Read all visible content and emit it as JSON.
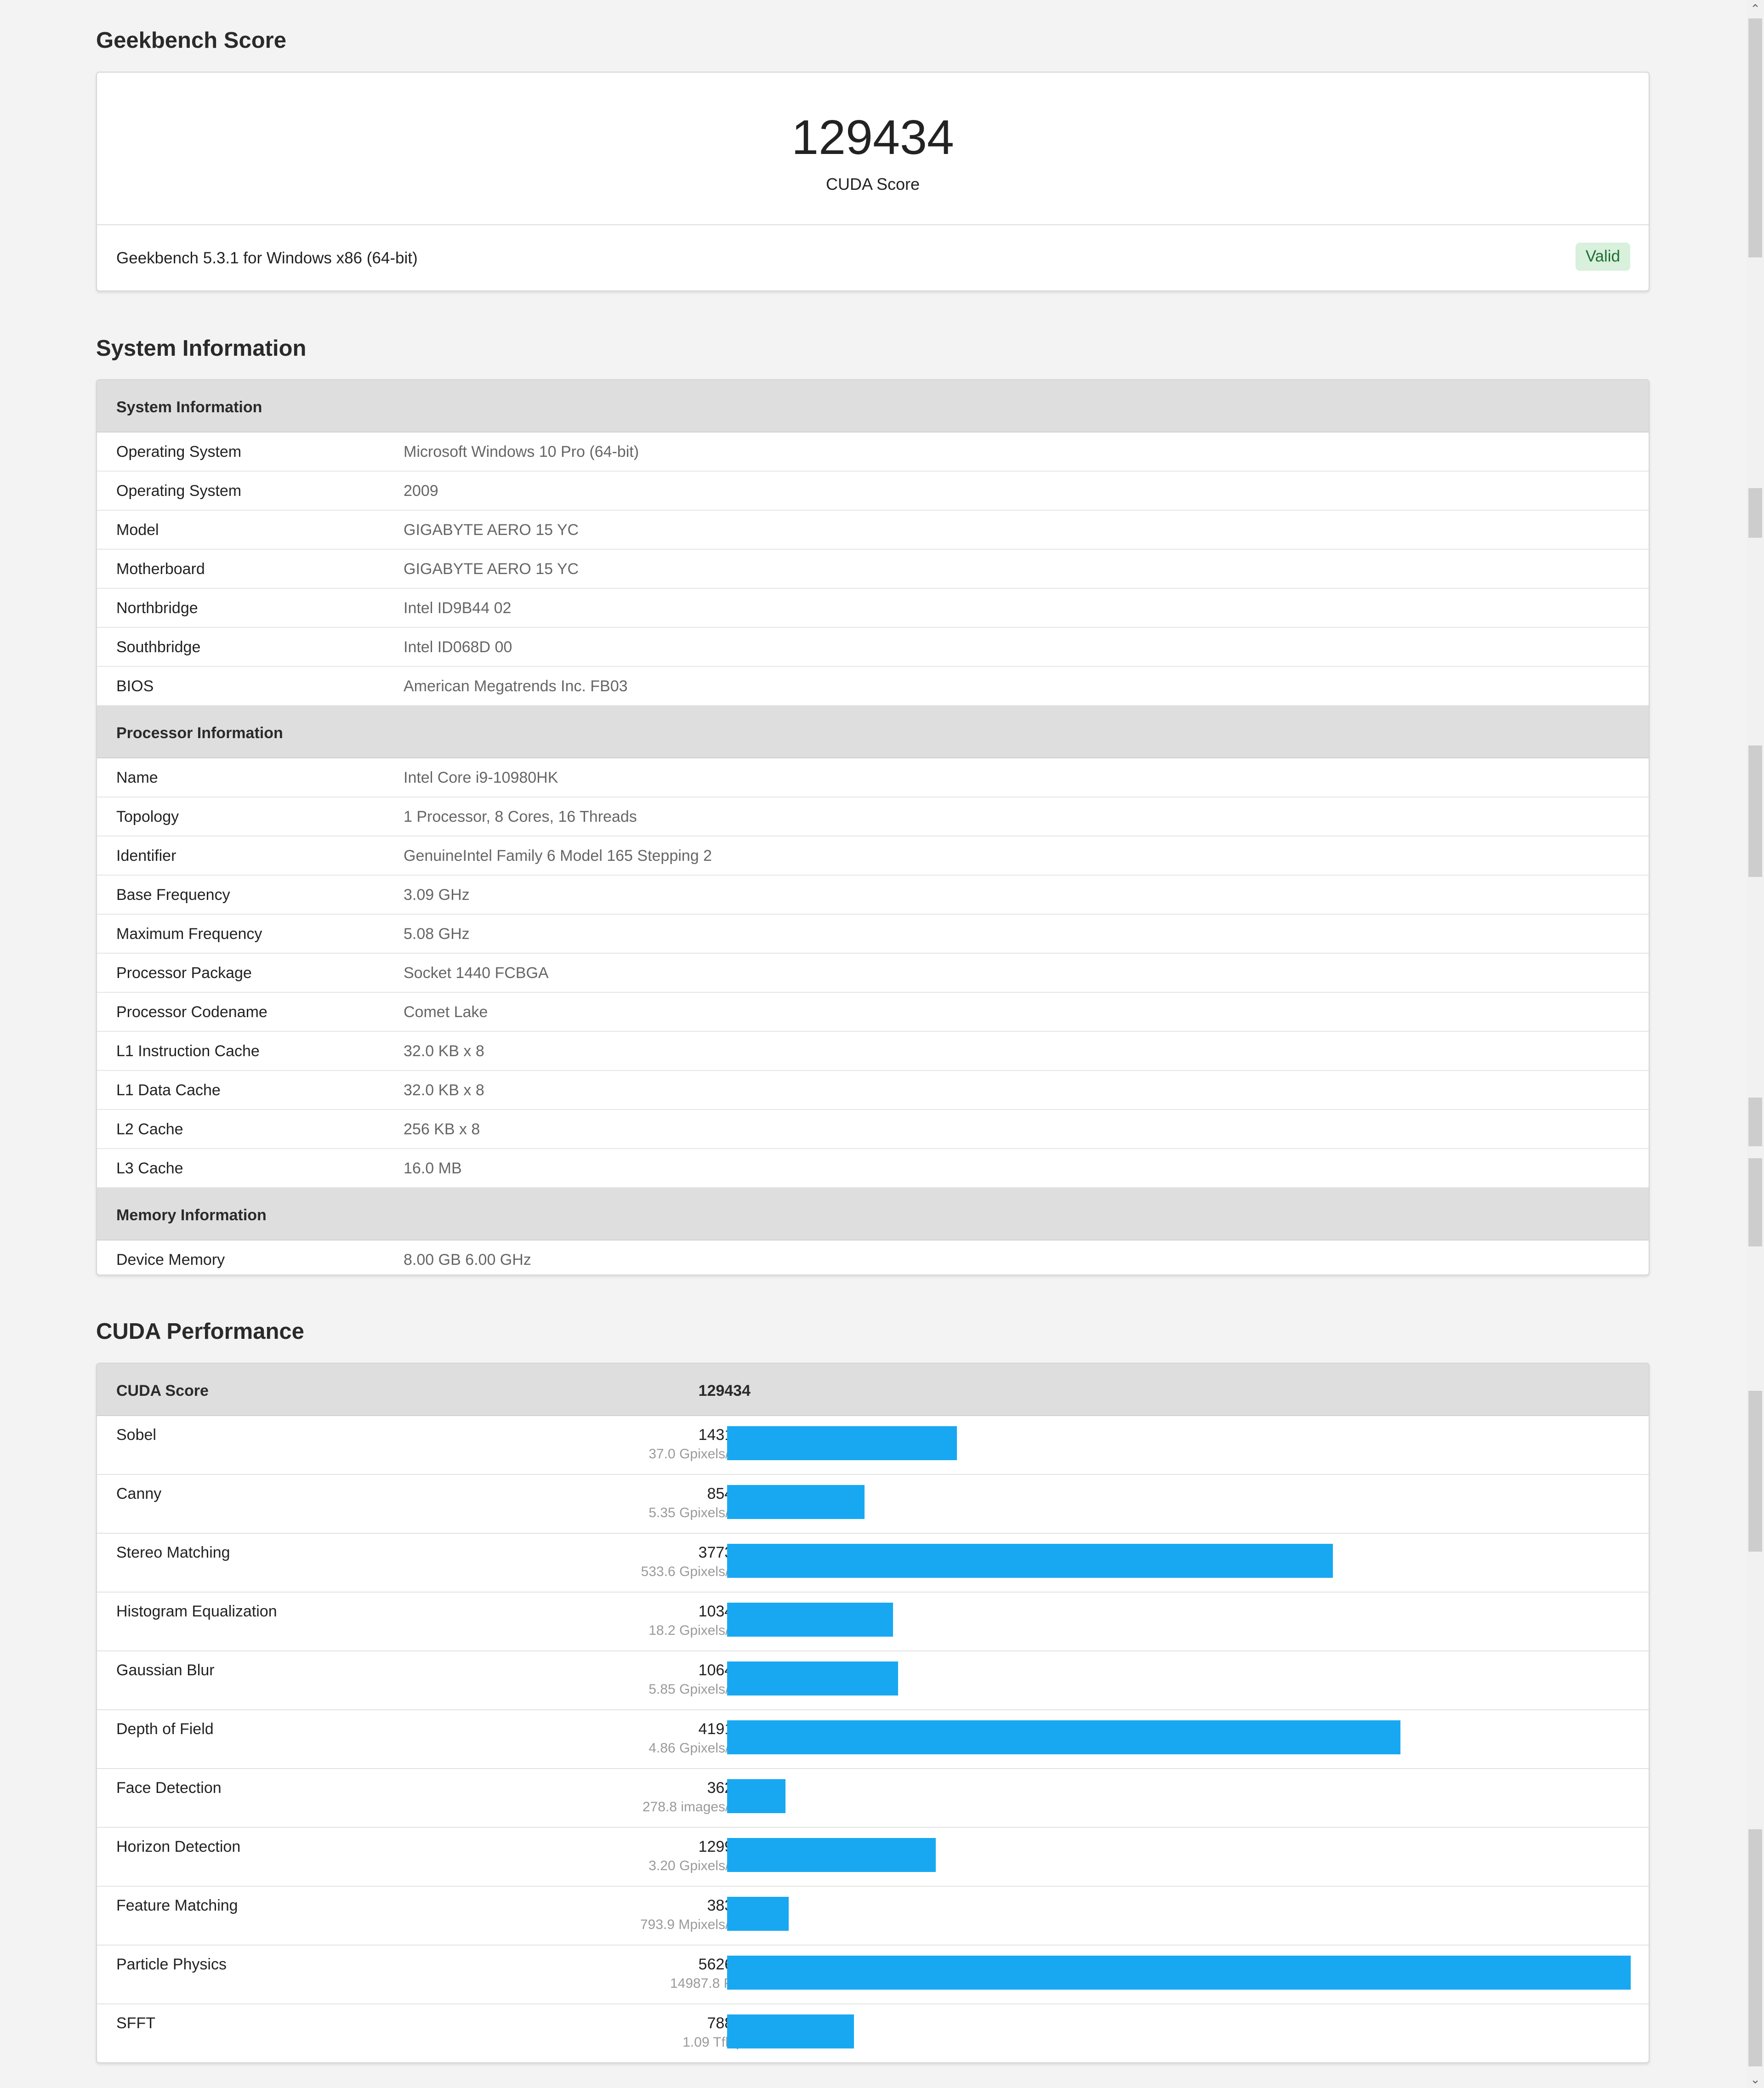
{
  "headings": {
    "score": "Geekbench Score",
    "system": "System Information",
    "cuda": "CUDA Performance"
  },
  "score_card": {
    "value": "129434",
    "label": "CUDA Score",
    "version": "Geekbench 5.3.1 for Windows x86 (64-bit)",
    "badge": "Valid"
  },
  "system_info": {
    "sections": [
      {
        "title": "System Information",
        "rows": [
          {
            "key": "Operating System",
            "value": "Microsoft Windows 10 Pro (64-bit)"
          },
          {
            "key": "Operating System",
            "value": "2009"
          },
          {
            "key": "Model",
            "value": "GIGABYTE AERO 15 YC"
          },
          {
            "key": "Motherboard",
            "value": "GIGABYTE AERO 15 YC"
          },
          {
            "key": "Northbridge",
            "value": "Intel ID9B44 02"
          },
          {
            "key": "Southbridge",
            "value": "Intel ID068D 00"
          },
          {
            "key": "BIOS",
            "value": "American Megatrends Inc. FB03"
          }
        ]
      },
      {
        "title": "Processor Information",
        "rows": [
          {
            "key": "Name",
            "value": "Intel Core i9-10980HK"
          },
          {
            "key": "Topology",
            "value": "1 Processor, 8 Cores, 16 Threads"
          },
          {
            "key": "Identifier",
            "value": "GenuineIntel Family 6 Model 165 Stepping 2"
          },
          {
            "key": "Base Frequency",
            "value": "3.09 GHz"
          },
          {
            "key": "Maximum Frequency",
            "value": "5.08 GHz"
          },
          {
            "key": "Processor Package",
            "value": "Socket 1440 FCBGA"
          },
          {
            "key": "Processor Codename",
            "value": "Comet Lake"
          },
          {
            "key": "L1 Instruction Cache",
            "value": "32.0 KB x 8"
          },
          {
            "key": "L1 Data Cache",
            "value": "32.0 KB x 8"
          },
          {
            "key": "L2 Cache",
            "value": "256 KB x 8"
          },
          {
            "key": "L3 Cache",
            "value": "16.0 MB"
          }
        ]
      },
      {
        "title": "Memory Information",
        "rows": [
          {
            "key": "Device Memory",
            "value": "8.00 GB 6.00 GHz"
          }
        ]
      }
    ]
  },
  "cuda_performance": {
    "header_label": "CUDA Score",
    "header_score": "129434",
    "bar_color": "#18a8f2",
    "max_score": 562694,
    "benchmarks": [
      {
        "name": "Sobel",
        "score": "143158",
        "value": 143158,
        "unit": "37.0 Gpixels/sec"
      },
      {
        "name": "Canny",
        "score": "85481",
        "value": 85481,
        "unit": "5.35 Gpixels/sec"
      },
      {
        "name": "Stereo Matching",
        "score": "377324",
        "value": 377324,
        "unit": "533.6 Gpixels/sec"
      },
      {
        "name": "Histogram Equalization",
        "score": "103408",
        "value": 103408,
        "unit": "18.2 Gpixels/sec"
      },
      {
        "name": "Gaussian Blur",
        "score": "106496",
        "value": 106496,
        "unit": "5.85 Gpixels/sec"
      },
      {
        "name": "Depth of Field",
        "score": "419182",
        "value": 419182,
        "unit": "4.86 Gpixels/sec"
      },
      {
        "name": "Face Detection",
        "score": "36214",
        "value": 36214,
        "unit": "278.8 images/sec"
      },
      {
        "name": "Horizon Detection",
        "score": "129915",
        "value": 129915,
        "unit": "3.20 Gpixels/sec"
      },
      {
        "name": "Feature Matching",
        "score": "38378",
        "value": 38378,
        "unit": "793.9 Mpixels/sec"
      },
      {
        "name": "Particle Physics",
        "score": "562694",
        "value": 562694,
        "unit": "14987.8 FPS"
      },
      {
        "name": "SFFT",
        "score": "78880",
        "value": 78880,
        "unit": "1.09 Tflops"
      }
    ]
  },
  "icons": {
    "scroll_up": "chevron-up-icon",
    "scroll_down": "chevron-down-icon"
  }
}
